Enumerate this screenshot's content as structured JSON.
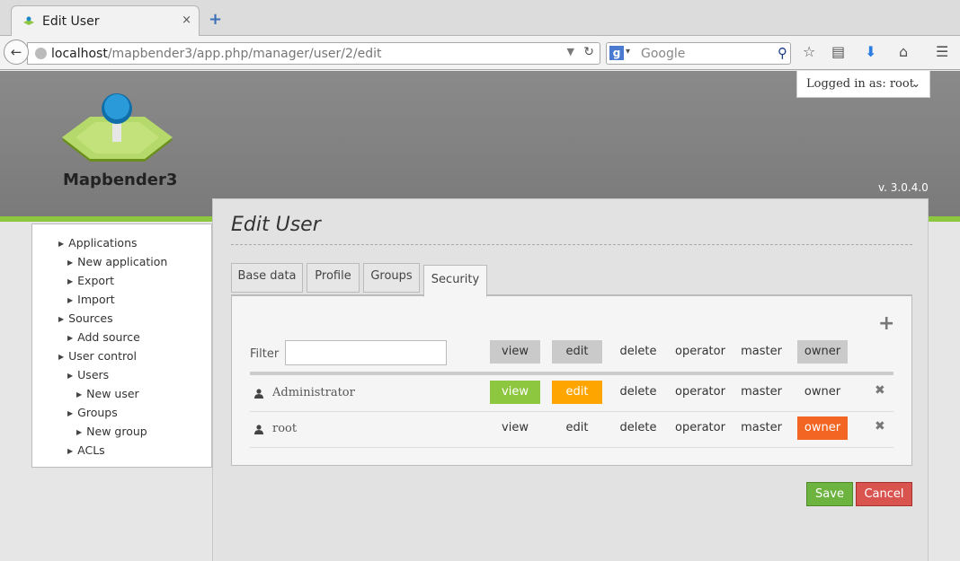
{
  "browser": {
    "tab_title": "Edit User",
    "tab_close": "×",
    "new_tab": "+",
    "url_host": "localhost",
    "url_path": "/mapbender3/app.php/manager/user/2/edit",
    "search_placeholder": "Google",
    "search_engine_letter": "g"
  },
  "header": {
    "logo_text": "Mapbender3",
    "version": "v. 3.0.4.0",
    "account": "Logged in as: root",
    "colors": {
      "brand_green": "#8dc63f",
      "logo_blue": "#1e88c8"
    }
  },
  "sidebar": {
    "items": [
      {
        "label": "Applications"
      },
      {
        "label": "New application"
      },
      {
        "label": "Export"
      },
      {
        "label": "Import"
      },
      {
        "label": "Sources"
      },
      {
        "label": "Add source"
      },
      {
        "label": "User control"
      },
      {
        "label": "Users"
      },
      {
        "label": "New user"
      },
      {
        "label": "Groups"
      },
      {
        "label": "New group"
      },
      {
        "label": "ACLs"
      }
    ]
  },
  "main": {
    "title": "Edit User",
    "tabs": [
      {
        "label": "Base data"
      },
      {
        "label": "Profile"
      },
      {
        "label": "Groups"
      },
      {
        "label": "Security",
        "active": true
      }
    ],
    "security": {
      "add_icon": "+",
      "filter_label": "Filter",
      "filter_value": "",
      "columns": [
        "view",
        "edit",
        "delete",
        "operator",
        "master",
        "owner"
      ],
      "rows": [
        {
          "name": "Administrator",
          "permissions": [
            "view",
            "edit",
            "delete",
            "operator",
            "master",
            "owner"
          ],
          "granted": [
            "view",
            "edit"
          ]
        },
        {
          "name": "root",
          "permissions": [
            "view",
            "edit",
            "delete",
            "operator",
            "master",
            "owner"
          ],
          "granted": [
            "owner"
          ]
        }
      ],
      "remove_icon": "✖"
    },
    "buttons": {
      "save": "Save",
      "cancel": "Cancel"
    }
  }
}
